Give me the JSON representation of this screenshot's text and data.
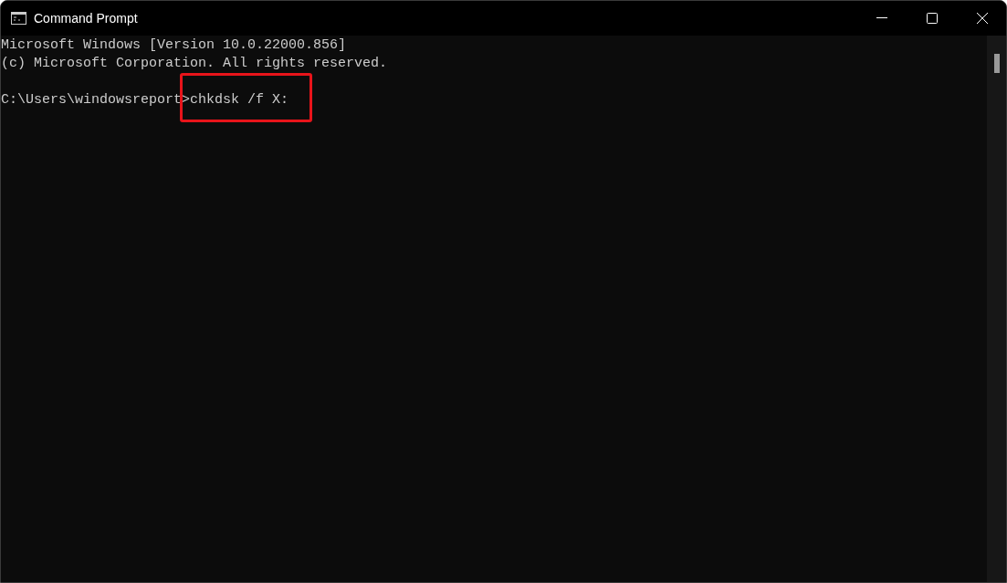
{
  "window": {
    "title": "Command Prompt"
  },
  "console": {
    "lines": [
      "Microsoft Windows [Version 10.0.22000.856]",
      "(c) Microsoft Corporation. All rights reserved."
    ],
    "prompt": {
      "path": "C:\\Users\\windowsreport>",
      "command": "chkdsk /f X:",
      "highlighted": true
    }
  }
}
